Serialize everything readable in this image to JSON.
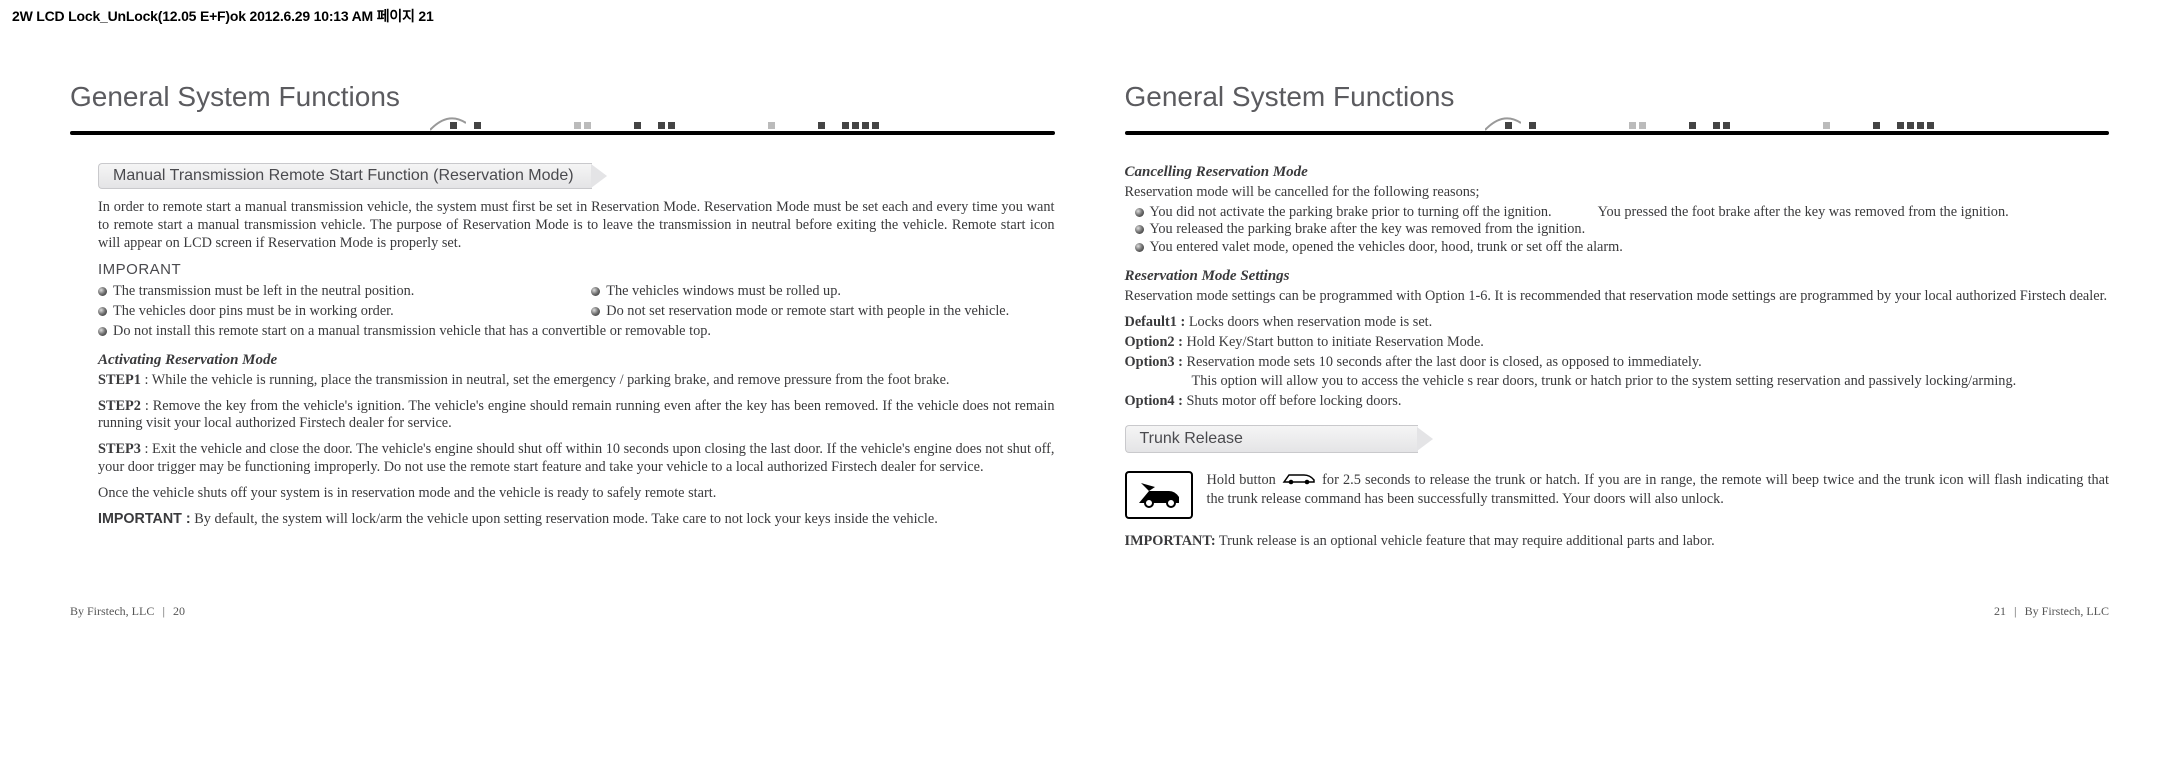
{
  "print_header": "2W LCD Lock_UnLock(12.05 E+F)ok  2012.6.29 10:13 AM  페이지 21",
  "left": {
    "title": "General System Functions",
    "banner": "Manual Transmission Remote Start Function (Reservation Mode)",
    "intro": "In order to remote start a manual transmission vehicle, the system must first be set in Reservation Mode.  Reservation Mode must be set each and every time you want to remote start a manual transmission vehicle. The purpose of Reservation Mode is to leave the transmission in neutral before exiting the vehicle. Remote start icon will appear on LCD screen if Reservation Mode is properly set.",
    "imp_head": "IMPORANT",
    "bullets": {
      "b1": "The transmission must be left in the neutral position.",
      "b2": "The vehicles windows must be rolled up.",
      "b3": "The vehicles door pins must be in working order.",
      "b4": "Do not set reservation mode or remote start with people in the vehicle.",
      "b5": "Do not install this remote start on a manual transmission vehicle that has a convertible or removable top."
    },
    "activating_head": "Activating Reservation Mode",
    "step1_label": "STEP1",
    "step1": " :  While the vehicle is running, place the transmission in neutral, set the emergency / parking brake, and remove pressure from the foot brake.",
    "step2_label": "STEP2",
    "step2": " :  Remove the key from the vehicle's ignition. The vehicle's engine should remain running even after the key has been removed. If the vehicle does not remain running visit your local authorized Firstech dealer for service.",
    "step3_label": "STEP3",
    "step3": " :  Exit the vehicle and close the door. The vehicle's engine should shut off within 10 seconds upon closing the last door. If the vehicle's engine does not shut off, your door trigger may be functioning improperly.  Do not use the remote start feature and take your vehicle to a local authorized Firstech dealer for service.",
    "once": "Once the vehicle shuts off your system is in reservation mode and the vehicle is ready to safely remote start.",
    "important_label": "IMPORTANT :",
    "important_text": "  By default, the system will lock/arm the vehicle upon setting reservation mode. Take care to not lock your keys inside the vehicle.",
    "footer_by": "By Firstech, LLC",
    "footer_page": "20"
  },
  "right": {
    "title": "General System Functions",
    "cancel_head": "Cancelling Reservation Mode",
    "cancel_intro": "Reservation mode will be cancelled for the following reasons;",
    "cancel_b1": "You did not activate the parking brake prior to turning off the ignition.",
    "cancel_b1b": "You pressed the foot brake after the key was removed from the ignition.",
    "cancel_b2": "You released the parking brake after the key was removed from the ignition.",
    "cancel_b3": "You entered valet mode, opened the vehicles door, hood, trunk or set off the alarm.",
    "settings_head": "Reservation Mode Settings",
    "settings_intro": "Reservation mode settings can be programmed with Option 1-6.  It is recommended that reservation mode settings are programmed by your local authorized Firstech dealer.",
    "d1_label": "Default1 :",
    "d1": " Locks doors when reservation mode is set.",
    "o2_label": "Option2 :",
    "o2": " Hold Key/Start button to initiate Reservation Mode.",
    "o3_label": "Option3 :",
    "o3": " Reservation mode sets 10 seconds after the last door is closed, as opposed to immediately.",
    "o3b": "This option will allow you to access the vehicle s rear doors, trunk or hatch prior to the system setting reservation and passively locking/arming.",
    "o4_label": "Option4 :",
    "o4": " Shuts motor off before locking doors.",
    "trunk_banner": "Trunk Release",
    "trunk_text_pre": "Hold button ",
    "trunk_text_post": " for 2.5 seconds to release the trunk or hatch. If you are in range, the remote will beep twice and the trunk icon will flash indicating that the trunk release command has been successfully transmitted. Your doors will also unlock.",
    "trunk_important_label": "IMPORTANT:",
    "trunk_important": " Trunk release is an optional vehicle feature that may require additional parts and labor.",
    "footer_by": "By Firstech, LLC",
    "footer_page": "21"
  }
}
